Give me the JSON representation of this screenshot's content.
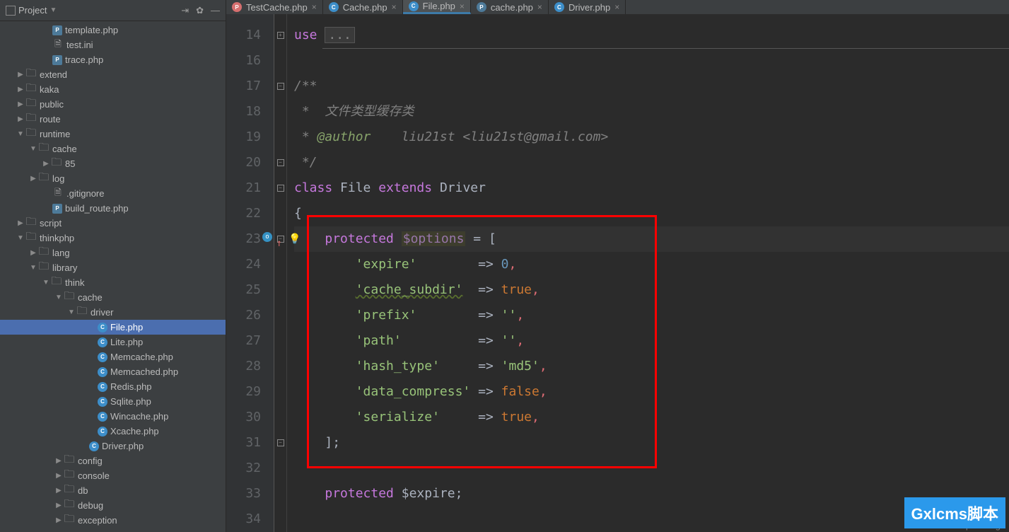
{
  "sidebar": {
    "title": "Project",
    "tree": [
      {
        "label": "template.php",
        "type": "php",
        "indent": 60
      },
      {
        "label": "test.ini",
        "type": "file",
        "indent": 60
      },
      {
        "label": "trace.php",
        "type": "php",
        "indent": 60
      },
      {
        "label": "extend",
        "type": "folder",
        "indent": 22,
        "toggle": "▶"
      },
      {
        "label": "kaka",
        "type": "folder",
        "indent": 22,
        "toggle": "▶"
      },
      {
        "label": "public",
        "type": "folder",
        "indent": 22,
        "toggle": "▶"
      },
      {
        "label": "route",
        "type": "folder",
        "indent": 22,
        "toggle": "▶"
      },
      {
        "label": "runtime",
        "type": "folder",
        "indent": 22,
        "toggle": "▼"
      },
      {
        "label": "cache",
        "type": "folder",
        "indent": 40,
        "toggle": "▼"
      },
      {
        "label": "85",
        "type": "folder",
        "indent": 58,
        "toggle": "▶"
      },
      {
        "label": "log",
        "type": "folder",
        "indent": 40,
        "toggle": "▶"
      },
      {
        "label": ".gitignore",
        "type": "file",
        "indent": 60
      },
      {
        "label": "build_route.php",
        "type": "php",
        "indent": 60
      },
      {
        "label": "script",
        "type": "folder",
        "indent": 22,
        "toggle": "▶"
      },
      {
        "label": "thinkphp",
        "type": "folder",
        "indent": 22,
        "toggle": "▼"
      },
      {
        "label": "lang",
        "type": "folder",
        "indent": 40,
        "toggle": "▶"
      },
      {
        "label": "library",
        "type": "folder",
        "indent": 40,
        "toggle": "▼"
      },
      {
        "label": "think",
        "type": "folder",
        "indent": 58,
        "toggle": "▼"
      },
      {
        "label": "cache",
        "type": "folder",
        "indent": 76,
        "toggle": "▼"
      },
      {
        "label": "driver",
        "type": "folder",
        "indent": 94,
        "toggle": "▼"
      },
      {
        "label": "File.php",
        "type": "phpc",
        "indent": 124,
        "active": true
      },
      {
        "label": "Lite.php",
        "type": "phpc",
        "indent": 124
      },
      {
        "label": "Memcache.php",
        "type": "phpc",
        "indent": 124
      },
      {
        "label": "Memcached.php",
        "type": "phpc",
        "indent": 124
      },
      {
        "label": "Redis.php",
        "type": "phpc",
        "indent": 124
      },
      {
        "label": "Sqlite.php",
        "type": "phpc",
        "indent": 124
      },
      {
        "label": "Wincache.php",
        "type": "phpc",
        "indent": 124
      },
      {
        "label": "Xcache.php",
        "type": "phpc",
        "indent": 124
      },
      {
        "label": "Driver.php",
        "type": "phpc",
        "indent": 112
      },
      {
        "label": "config",
        "type": "folder",
        "indent": 76,
        "toggle": "▶"
      },
      {
        "label": "console",
        "type": "folder",
        "indent": 76,
        "toggle": "▶"
      },
      {
        "label": "db",
        "type": "folder",
        "indent": 76,
        "toggle": "▶"
      },
      {
        "label": "debug",
        "type": "folder",
        "indent": 76,
        "toggle": "▶"
      },
      {
        "label": "exception",
        "type": "folder",
        "indent": 76,
        "toggle": "▶"
      }
    ]
  },
  "tabs": [
    {
      "label": "TestCache.php",
      "icon": "test"
    },
    {
      "label": "Cache.php",
      "icon": "c"
    },
    {
      "label": "File.php",
      "icon": "c",
      "active": true
    },
    {
      "label": "cache.php",
      "icon": "php"
    },
    {
      "label": "Driver.php",
      "icon": "c"
    }
  ],
  "code": {
    "lines": [
      14,
      16,
      17,
      18,
      19,
      20,
      21,
      22,
      23,
      24,
      25,
      26,
      27,
      28,
      29,
      30,
      31,
      32,
      33,
      34
    ],
    "line14_kw": "use",
    "line14_box": "...",
    "comment_open": "/**",
    "comment_body1": " *  文件类型缓存类",
    "comment_body2_star": " * ",
    "comment_body2_tag": "@author",
    "comment_body2_rest": "    liu21st <liu21st@gmail.com>",
    "comment_close": " */",
    "class_kw": "class",
    "class_name": "File",
    "extends_kw": "extends",
    "parent_name": "Driver",
    "brace_open": "{",
    "protected_kw": "protected",
    "options_var": "$options",
    "eq": "=",
    "bracket_open": "[",
    "opt1_key": "'expire'",
    "opt1_val": "0",
    "opt2_key": "'cache_subdir'",
    "opt2_val": "true",
    "opt3_key": "'prefix'",
    "opt3_val": "''",
    "opt4_key": "'path'",
    "opt4_val": "''",
    "opt5_key": "'hash_type'",
    "opt5_val": "'md5'",
    "opt6_key": "'data_compress'",
    "opt6_val": "false",
    "opt7_key": "'serialize'",
    "opt7_val": "true",
    "arrow": "=>",
    "bracket_close": "];",
    "expire_line_kw": "protected",
    "expire_var": "$expire",
    "semicolon": ";",
    "comma": ","
  },
  "watermark": "Gxlcms脚本",
  "url_mark": "https://blog"
}
